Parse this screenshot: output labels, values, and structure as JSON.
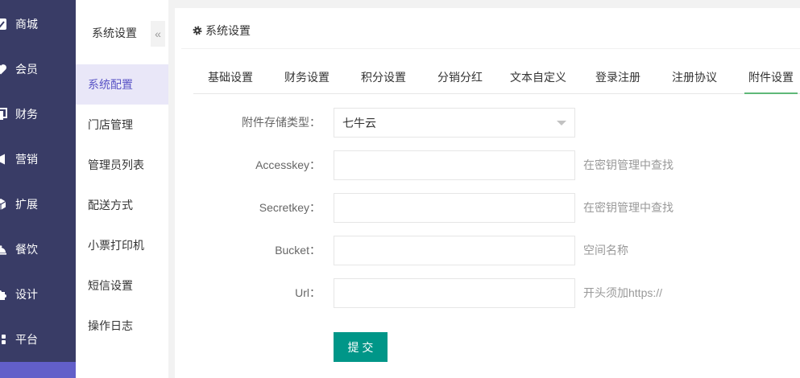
{
  "sidebar": {
    "items": [
      {
        "label": "商城",
        "icon": "check-square-icon"
      },
      {
        "label": "会员",
        "icon": "heart-icon"
      },
      {
        "label": "财务",
        "icon": "copy-icon"
      },
      {
        "label": "营销",
        "icon": "megaphone-icon"
      },
      {
        "label": "扩展",
        "icon": "cube-icon"
      },
      {
        "label": "餐饮",
        "icon": "food-cover-icon"
      },
      {
        "label": "设计",
        "icon": "puzzle-icon"
      },
      {
        "label": "平台",
        "icon": "grid-icon"
      }
    ]
  },
  "subnav": {
    "title": "系统设置",
    "collapse_glyph": "«",
    "items": [
      {
        "label": "系统配置",
        "active": true
      },
      {
        "label": "门店管理",
        "active": false
      },
      {
        "label": "管理员列表",
        "active": false
      },
      {
        "label": "配送方式",
        "active": false
      },
      {
        "label": "小票打印机",
        "active": false
      },
      {
        "label": "短信设置",
        "active": false
      },
      {
        "label": "操作日志",
        "active": false
      }
    ]
  },
  "panel": {
    "title": "系统设置",
    "title_icon": "gear-icon",
    "tabs": [
      {
        "label": "基础设置",
        "active": false
      },
      {
        "label": "财务设置",
        "active": false
      },
      {
        "label": "积分设置",
        "active": false
      },
      {
        "label": "分销分红",
        "active": false
      },
      {
        "label": "文本自定义",
        "active": false
      },
      {
        "label": "登录注册",
        "active": false
      },
      {
        "label": "注册协议",
        "active": false
      },
      {
        "label": "附件设置",
        "active": true
      }
    ],
    "form": {
      "storage_type": {
        "label": "附件存储类型：",
        "value": "七牛云"
      },
      "fields": [
        {
          "label": "Accesskey：",
          "value": "",
          "hint": "在密钥管理中查找"
        },
        {
          "label": "Secretkey：",
          "value": "",
          "hint": "在密钥管理中查找"
        },
        {
          "label": "Bucket：",
          "value": "",
          "hint": "空间名称"
        },
        {
          "label": "Url：",
          "value": "",
          "hint": "开头须加https://"
        }
      ],
      "submit_label": "提 交"
    }
  },
  "colors": {
    "sidebar_bg": "#393c66",
    "sidebar_active_bg": "#625fc9",
    "subnav_active_bg": "#e9e7f8",
    "subnav_active_text": "#5a54c6",
    "tab_active_underline": "#5fb878",
    "submit_button_bg": "#009688"
  }
}
